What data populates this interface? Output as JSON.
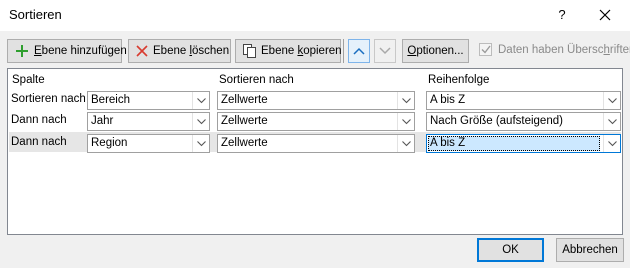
{
  "window": {
    "title": "Sortieren",
    "help": "?",
    "close_icon": "close-icon"
  },
  "toolbar": {
    "add_level": {
      "prefix": "E",
      "underlined": "",
      "rest": "bene hinzufügen",
      "icon": "plus-icon",
      "icon_color": "#2e9e2e"
    },
    "delete_level": {
      "text_before": "Ebene ",
      "underlined": "l",
      "text_after": "öschen",
      "icon": "delete-x-icon",
      "icon_color": "#d83b2f"
    },
    "copy_level": {
      "text_before": "Ebene ",
      "underlined": "k",
      "text_after": "opieren",
      "icon": "copy-icon"
    },
    "move_up_icon": "chevron-up-icon",
    "move_down_icon": "chevron-down-icon",
    "options": {
      "underlined": "O",
      "rest": "ptionen..."
    },
    "headers_checkbox": {
      "label_before": "Daten haben Übersc",
      "underlined": "h",
      "label_after": "riften",
      "checked": true,
      "disabled": true
    }
  },
  "grid": {
    "headers": {
      "column": "Spalte",
      "sort_on": "Sortieren nach",
      "order": "Reihenfolge"
    },
    "rows": [
      {
        "label": "Sortieren nach",
        "column": "Bereich",
        "sort_on": "Zellwerte",
        "order": "A bis Z",
        "selected": false
      },
      {
        "label": "Dann nach",
        "column": "Jahr",
        "sort_on": "Zellwerte",
        "order": "Nach Größe (aufsteigend)",
        "selected": false
      },
      {
        "label": "Dann nach",
        "column": "Region",
        "sort_on": "Zellwerte",
        "order": "A bis Z",
        "selected": true
      }
    ]
  },
  "buttons": {
    "ok": "OK",
    "cancel": "Abbrechen"
  },
  "colors": {
    "accent": "#0078d7",
    "selection": "#cce8ff",
    "row_highlight": "#e6e6e6"
  }
}
